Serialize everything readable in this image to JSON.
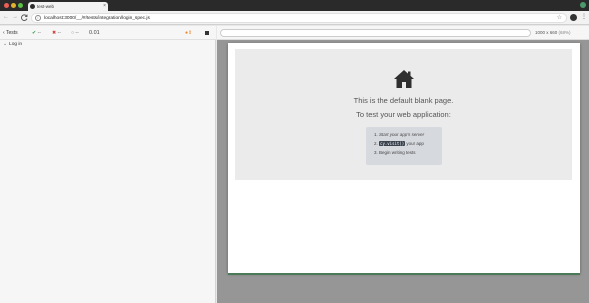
{
  "browser": {
    "tab_title": "test-web",
    "tab_close": "×",
    "nav": {
      "back": "←",
      "forward": "→",
      "reload": "C"
    },
    "url": "localhost:3000/__/#/tests/integration/login_spec.js",
    "info_icon": "i",
    "bookmark_star": "☆",
    "menu": "⋮"
  },
  "reporter": {
    "tests_label": "Tests",
    "back_chevron": "‹",
    "passed_icon": "✔",
    "passed_count": "--",
    "failed_icon": "✖",
    "failed_count": "--",
    "pending_icon": "○",
    "pending_count": "--",
    "duration": "0.01",
    "autoscroll_icon": "●⇕",
    "suites": [
      {
        "chevron": "⌄",
        "label": "Log in"
      }
    ]
  },
  "aut": {
    "viewport": "1000 x 660",
    "viewport_pct": "(68%)",
    "blank_page": {
      "title": "This is the default blank page.",
      "subtitle": "To test your web application:",
      "steps": [
        {
          "num": "1.",
          "text": "Start your app's server"
        },
        {
          "num": "2.",
          "code": "cy.visit()",
          "text": " your app"
        },
        {
          "num": "3.",
          "text": "Begin writing tests"
        }
      ]
    }
  },
  "colors": {
    "pass": "#2b9b3b",
    "fail": "#d13b3b",
    "autoscroll": "#e7862c",
    "aut_background": "#969696",
    "frame_accent": "#4b7a58"
  },
  "icons": {
    "home": "home-icon",
    "stop": "stop-icon",
    "favicon": "cypress-favicon-icon",
    "profile": "profile-avatar-icon"
  }
}
